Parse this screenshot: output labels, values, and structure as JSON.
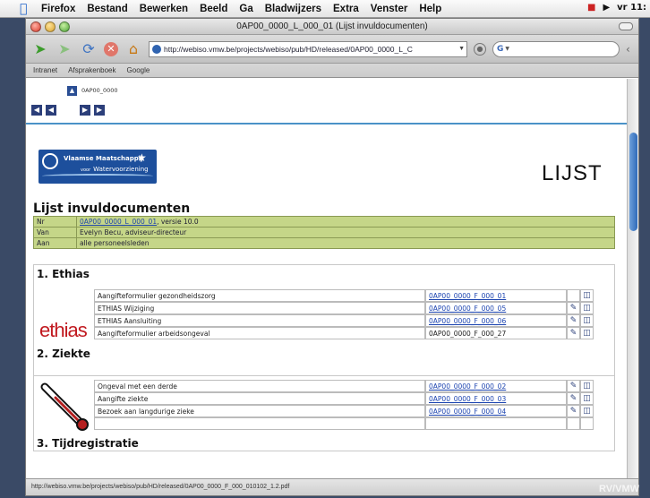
{
  "menubar": {
    "app": "Firefox",
    "items": [
      "Bestand",
      "Bewerken",
      "Beeld",
      "Ga",
      "Bladwijzers",
      "Extra",
      "Venster",
      "Help"
    ],
    "clock": "vr 11:"
  },
  "window": {
    "title": "0AP00_0000_L_000_01 (Lijst invuldocumenten)"
  },
  "navbar": {
    "url": "http://webiso.vmw.be/projects/webiso/pub/HD/released/0AP00_0000_L_C",
    "search_prefix": "G"
  },
  "bookmarks": [
    "Intranet",
    "Afsprakenboek",
    "Google"
  ],
  "doc": {
    "id_label": "0AP00_0000",
    "logo_line1": "Vlaamse Maatschappij",
    "logo_line2_small": "voor",
    "logo_line2": "Watervoorziening",
    "big_title": "LIJST",
    "heading": "Lijst invuldocumenten",
    "meta": [
      {
        "key": "Nr",
        "link": "0AP00_0000_L_000_01",
        "rest": ", versie 10.0"
      },
      {
        "key": "Van",
        "value": "Evelyn Becu, adviseur-directeur"
      },
      {
        "key": "Aan",
        "value": "alle personeelsleden"
      }
    ],
    "sections": [
      {
        "title": "1. Ethias",
        "logo_text": "ethias",
        "rows": [
          {
            "name": "Aangifteformulier gezondheidszorg",
            "code": "0AP00_0000_F_000_01",
            "link": true
          },
          {
            "name": "ETHIAS Wijziging",
            "code": "0AP00_0000_F_000_05",
            "link": true
          },
          {
            "name": "ETHIAS Aansluiting",
            "code": "0AP00_0000_F_000_06",
            "link": true
          },
          {
            "name": "Aangifteformulier arbeidsongeval",
            "code": "0AP00_0000_F_000_27",
            "link": false
          }
        ]
      },
      {
        "title": "2. Ziekte",
        "rows": [
          {
            "name": "Ongeval met een derde",
            "code": "0AP00_0000_F_000_02",
            "link": true
          },
          {
            "name": "Aangifte ziekte",
            "code": "0AP00_0000_F_000_03",
            "link": true
          },
          {
            "name": "Bezoek aan langdurige zieke",
            "code": "0AP00_0000_F_000_04",
            "link": true
          }
        ]
      },
      {
        "title": "3. Tijdregistratie"
      }
    ]
  },
  "statusbar": "http://webiso.vmw.be/projects/webiso/pub/HD/released/0AP00_0000_F_000_010102_1.2.pdf",
  "watermark": "RV/VMW"
}
